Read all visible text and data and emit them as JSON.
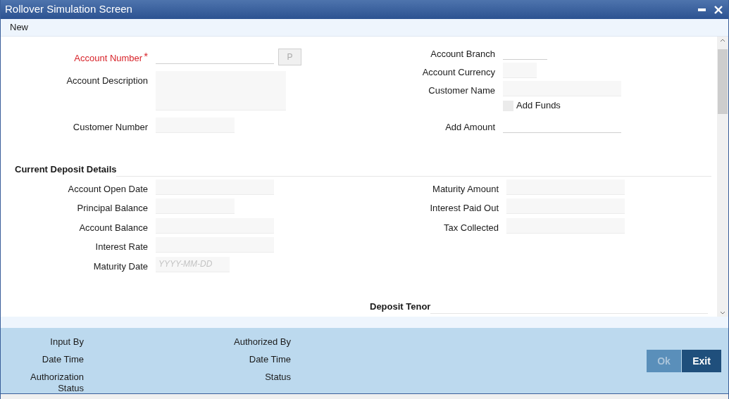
{
  "window": {
    "title": "Rollover Simulation Screen"
  },
  "menu": [
    {
      "label": "New"
    }
  ],
  "header_left": [
    {
      "label": "Account Number",
      "kind": "lookup",
      "required": true,
      "required_mark": "*",
      "button": "P"
    },
    {
      "label": "Account Description",
      "kind": "textarea"
    },
    {
      "label": "Customer Number",
      "kind": "box"
    }
  ],
  "header_right": [
    {
      "label": "Account Branch",
      "kind": "line"
    },
    {
      "label": "Account Currency",
      "kind": "box"
    },
    {
      "label": "Customer Name",
      "kind": "box"
    },
    {
      "label": "Add Funds",
      "kind": "checkbox",
      "checked": false
    },
    {
      "label": "Add Amount",
      "kind": "line"
    }
  ],
  "current_deposit_details": {
    "title": "Current Deposit Details",
    "left": [
      {
        "label": "Account Open Date",
        "kind": "box"
      },
      {
        "label": "Principal Balance",
        "kind": "box"
      },
      {
        "label": "Account Balance",
        "kind": "box"
      },
      {
        "label": "Interest Rate",
        "kind": "box"
      },
      {
        "label": "Maturity Date",
        "kind": "box",
        "placeholder": "YYYY-MM-DD"
      }
    ],
    "right": [
      {
        "label": "Maturity Amount",
        "kind": "box"
      },
      {
        "label": "Interest Paid Out",
        "kind": "box"
      },
      {
        "label": "Tax Collected",
        "kind": "box"
      }
    ]
  },
  "deposit_tenor": {
    "title": "Deposit Tenor"
  },
  "footer": {
    "left": [
      {
        "label": "Input By"
      },
      {
        "label": "Date Time"
      },
      {
        "label": "Authorization Status"
      }
    ],
    "right": [
      {
        "label": "Authorized By"
      },
      {
        "label": "Date Time"
      },
      {
        "label": "Status"
      }
    ],
    "buttons": [
      {
        "label": "Ok",
        "disabled": true
      },
      {
        "label": "Exit",
        "disabled": false
      }
    ]
  }
}
